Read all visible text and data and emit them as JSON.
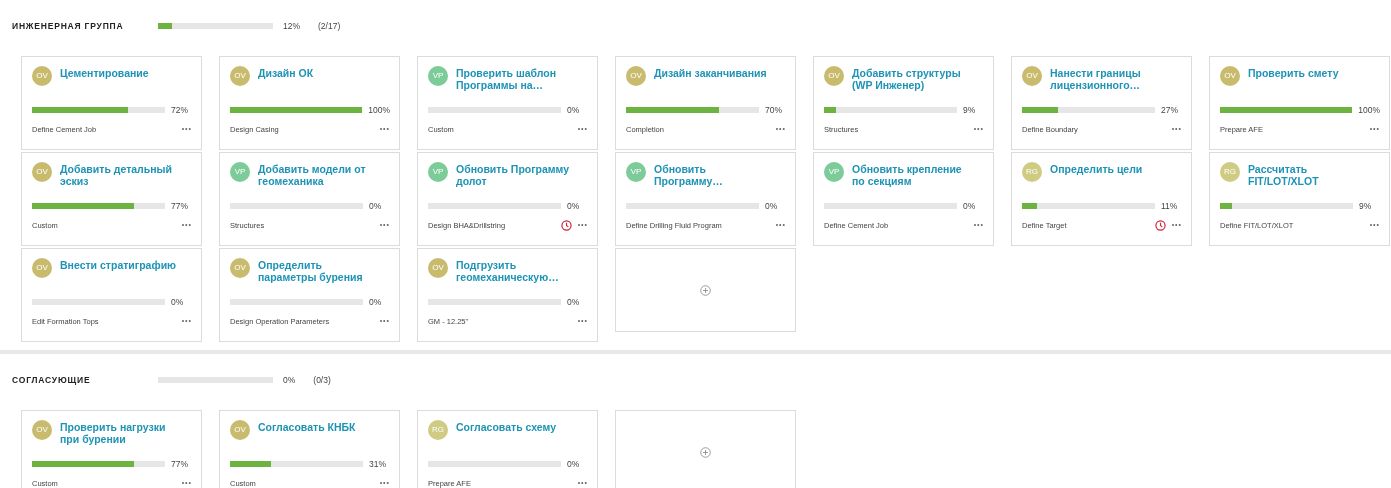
{
  "groups": [
    {
      "title": "ИНЖЕНЕРНАЯ ГРУППА",
      "level": 0.12,
      "percent": "12%",
      "count": "(2/17)",
      "tasks": [
        {
          "avatar": "OV",
          "color": "#c9bb6e",
          "title": "Цементирование",
          "level": 0.72,
          "percent": "72%",
          "category": "Define Cement Job",
          "menu": "•••",
          "overdue": false
        },
        {
          "avatar": "OV",
          "color": "#c9bb6e",
          "title": "Дизайн ОК",
          "level": 1,
          "percent": "100%",
          "category": "Design Casing",
          "menu": "•••",
          "overdue": false
        },
        {
          "avatar": "VP",
          "color": "#7dcb98",
          "title": "Проверить шаблон Программы на…",
          "level": 0,
          "percent": "0%",
          "category": "Custom",
          "menu": "•••",
          "overdue": false
        },
        {
          "avatar": "OV",
          "color": "#c9bb6e",
          "title": "Дизайн заканчивания",
          "level": 0.7,
          "percent": "70%",
          "category": "Completion",
          "menu": "•••",
          "overdue": false
        },
        {
          "avatar": "OV",
          "color": "#c9bb6e",
          "title": "Добавить структуры (WP Инженер)",
          "level": 0.09,
          "percent": "9%",
          "category": "Structures",
          "menu": "•••",
          "overdue": false
        },
        {
          "avatar": "OV",
          "color": "#c9bb6e",
          "title": "Нанести границы лицензионного…",
          "level": 0.27,
          "percent": "27%",
          "category": "Define Boundary",
          "menu": "•••",
          "overdue": false
        },
        {
          "avatar": "OV",
          "color": "#c9bb6e",
          "title": "Проверить смету",
          "level": 1,
          "percent": "100%",
          "category": "Prepare AFE",
          "menu": "•••",
          "overdue": false
        },
        {
          "avatar": "OV",
          "color": "#c9bb6e",
          "title": "Добавить детальный эскиз",
          "level": 0.77,
          "percent": "77%",
          "category": "Custom",
          "menu": "•••",
          "overdue": false
        },
        {
          "avatar": "VP",
          "color": "#7dcb98",
          "title": "Добавить модели от геомеханика",
          "level": 0,
          "percent": "0%",
          "category": "Structures",
          "menu": "•••",
          "overdue": false
        },
        {
          "avatar": "VP",
          "color": "#7dcb98",
          "title": "Обновить Программу долот",
          "level": 0,
          "percent": "0%",
          "category": "Design BHA&Drillstring",
          "menu": "•••",
          "overdue": true
        },
        {
          "avatar": "VP",
          "color": "#7dcb98",
          "title": "Обновить Программу…",
          "level": 0,
          "percent": "0%",
          "category": "Define Drilling Fluid Program",
          "menu": "•••",
          "overdue": false
        },
        {
          "avatar": "VP",
          "color": "#7dcb98",
          "title": "Обновить крепление по секциям",
          "level": 0,
          "percent": "0%",
          "category": "Define Cement Job",
          "menu": "•••",
          "overdue": false
        },
        {
          "avatar": "RG",
          "color": "#cfcb82",
          "title": "Определить цели",
          "level": 0.11,
          "percent": "11%",
          "category": "Define Target",
          "menu": "•••",
          "overdue": true
        },
        {
          "avatar": "RG",
          "color": "#cfcb82",
          "title": "Рассчитать FIT/LOT/XLOT",
          "level": 0.09,
          "percent": "9%",
          "category": "Define FIT/LOT/XLOT",
          "menu": "•••",
          "overdue": false
        },
        {
          "avatar": "OV",
          "color": "#c9bb6e",
          "title": "Внести стратиграфию",
          "level": 0,
          "percent": "0%",
          "category": "Edit Formation Tops",
          "menu": "•••",
          "overdue": false
        },
        {
          "avatar": "OV",
          "color": "#c9bb6e",
          "title": "Определить параметры бурения",
          "level": 0,
          "percent": "0%",
          "category": "Design Operation Parameters",
          "menu": "•••",
          "overdue": false
        },
        {
          "avatar": "OV",
          "color": "#c9bb6e",
          "title": "Подгрузить геомеханическую…",
          "level": 0,
          "percent": "0%",
          "category": "GM - 12.25\"",
          "menu": "•••",
          "overdue": false
        }
      ]
    },
    {
      "title": "СОГЛАСУЮЩИЕ",
      "level": 0,
      "percent": "0%",
      "count": "(0/3)",
      "tasks": [
        {
          "avatar": "OV",
          "color": "#c9bb6e",
          "title": "Проверить нагрузки при бурении",
          "level": 0.77,
          "percent": "77%",
          "category": "Custom",
          "menu": "•••",
          "overdue": false
        },
        {
          "avatar": "OV",
          "color": "#c9bb6e",
          "title": "Согласовать КНБК",
          "level": 0.31,
          "percent": "31%",
          "category": "Custom",
          "menu": "•••",
          "overdue": false
        },
        {
          "avatar": "RG",
          "color": "#cfcb82",
          "title": "Согласовать схему",
          "level": 0,
          "percent": "0%",
          "category": "Prepare AFE",
          "menu": "•••",
          "overdue": false
        }
      ]
    }
  ]
}
